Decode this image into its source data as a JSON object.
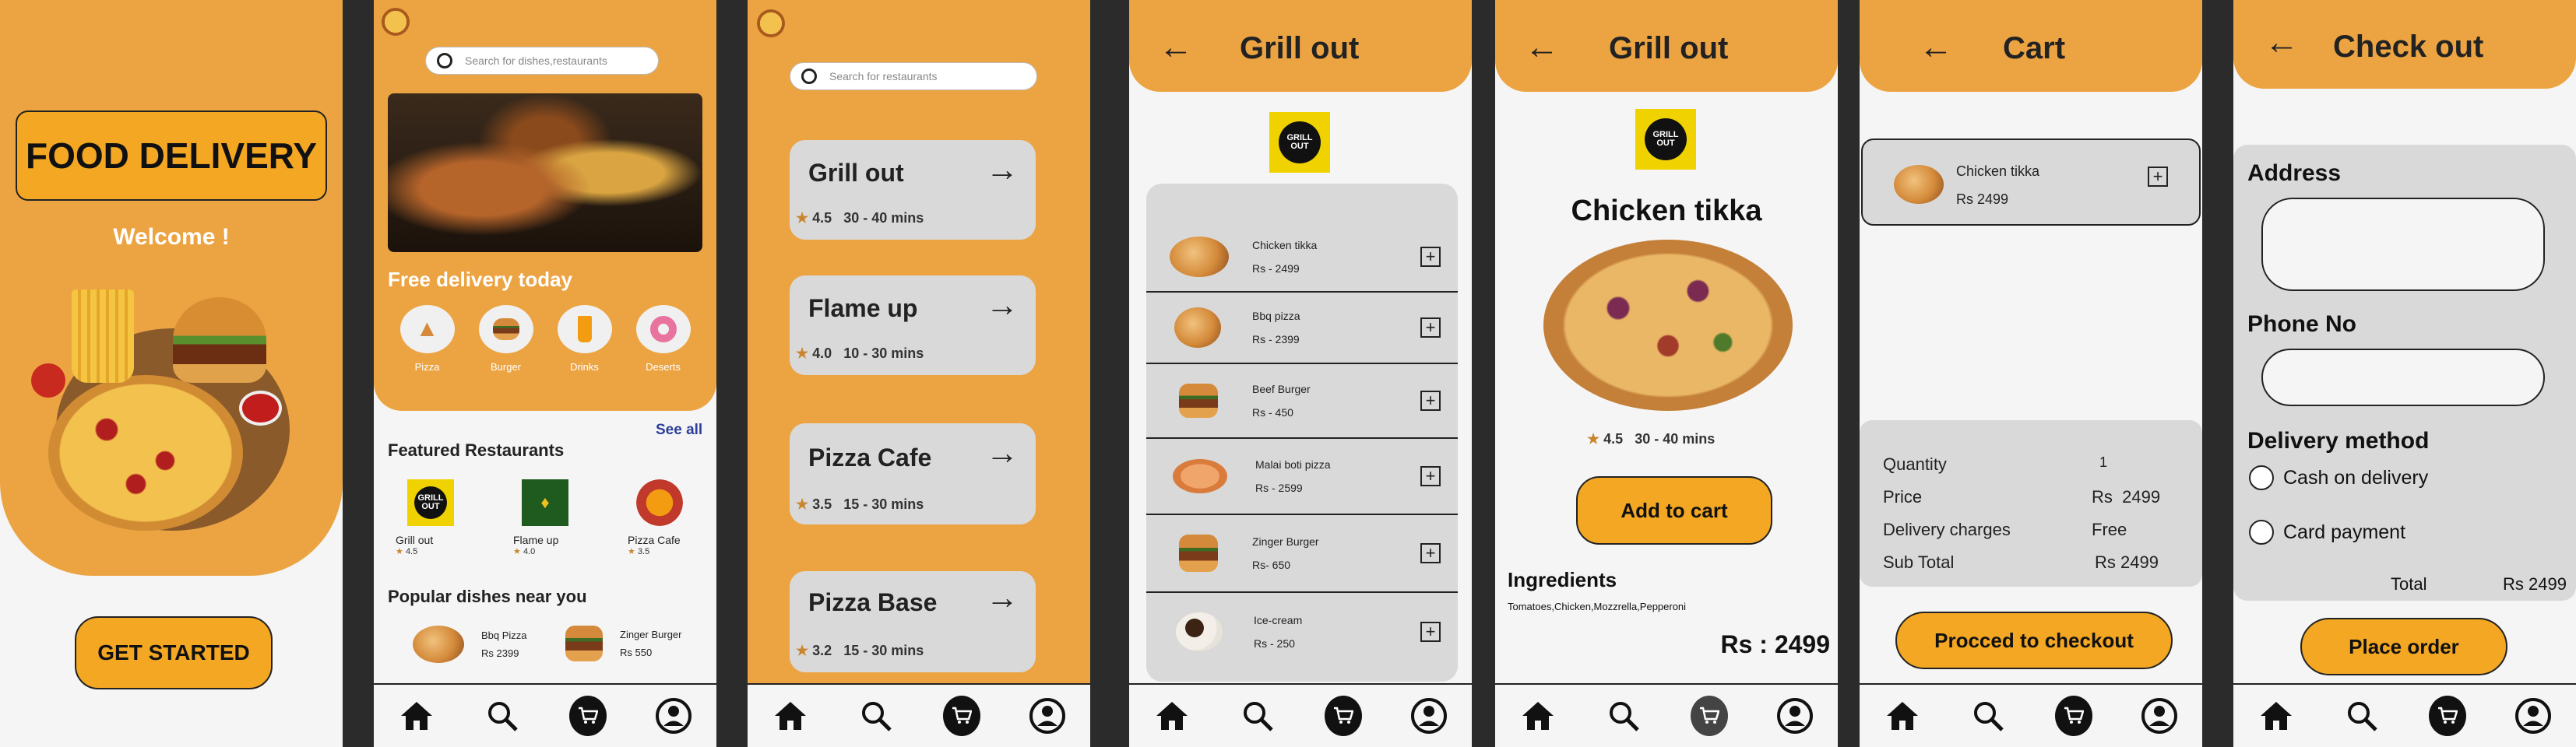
{
  "colors": {
    "accent": "#eca443",
    "button": "#f3a723",
    "card": "#d9d9d9",
    "star": "#c9852e",
    "bg": "#f5f5f5"
  },
  "welcome": {
    "title": "FOOD DELIVERY",
    "subtitle": "Welcome !",
    "cta": "GET STARTED"
  },
  "home": {
    "search_placeholder": "Search for dishes,restaurants",
    "free_delivery": "Free delivery today",
    "categories": [
      "Pizza",
      "Burger",
      "Drinks",
      "Deserts"
    ],
    "featured_title": "Featured Restaurants",
    "see_all": "See all",
    "restaurants": [
      {
        "name": "Grill out",
        "rating": "4.5",
        "logo": "GRILL OUT"
      },
      {
        "name": "Flame up",
        "rating": "4.0",
        "logo": ""
      },
      {
        "name": "Pizza Cafe",
        "rating": "3.5",
        "logo": ""
      }
    ],
    "popular_title": "Popular dishes near you",
    "popular": [
      {
        "name": "Bbq Pizza",
        "price": "Rs 2399"
      },
      {
        "name": "Zinger Burger",
        "price": "Rs 550"
      }
    ]
  },
  "restaurants": {
    "search_placeholder": "Search for restaurants",
    "items": [
      {
        "name": "Grill out",
        "rating": "4.5",
        "time": "30 - 40  mins"
      },
      {
        "name": "Flame up",
        "rating": "4.0",
        "time": "10 - 30  mins"
      },
      {
        "name": "Pizza Cafe",
        "rating": "3.5",
        "time": "15 - 30  mins"
      },
      {
        "name": "Pizza Base",
        "rating": "3.2",
        "time": "15 - 30  mins"
      }
    ]
  },
  "menu": {
    "title": "Grill out",
    "logo": "GRILL OUT",
    "items": [
      {
        "name": "Chicken tikka",
        "price": "Rs - 2499"
      },
      {
        "name": "Bbq pizza",
        "price": "Rs - 2399"
      },
      {
        "name": "Beef Burger",
        "price": "Rs - 450"
      },
      {
        "name": "Malai boti pizza",
        "price": "Rs - 2599"
      },
      {
        "name": "Zinger Burger",
        "price": "Rs- 650"
      },
      {
        "name": "Ice-cream",
        "price": "Rs - 250"
      }
    ]
  },
  "detail": {
    "title": "Grill out",
    "logo": "GRILL OUT",
    "dish": "Chicken tikka",
    "rating": "4.5",
    "time": "30 - 40  mins",
    "add_to_cart": "Add to cart",
    "ingredients_title": "Ingredients",
    "ingredients": "Tomatoes,Chicken,Mozzrella,Pepperoni",
    "price": "Rs : 2499"
  },
  "cart": {
    "title": "Cart",
    "item": {
      "name": "Chicken tikka",
      "price": "Rs 2499"
    },
    "summary": [
      {
        "label": "Quantity",
        "value": "1"
      },
      {
        "label": "Price",
        "value": "Rs  2499"
      },
      {
        "label": "Delivery charges",
        "value": "Free"
      },
      {
        "label": "Sub Total",
        "value": "Rs 2499"
      }
    ],
    "checkout": "Procced to checkout"
  },
  "checkout": {
    "title": "Check out",
    "address_label": "Address",
    "phone_label": "Phone No",
    "delivery_label": "Delivery method",
    "options": [
      "Cash on delivery",
      "Card payment"
    ],
    "total_label": "Total",
    "total_value": "Rs 2499",
    "place_order": "Place order"
  }
}
